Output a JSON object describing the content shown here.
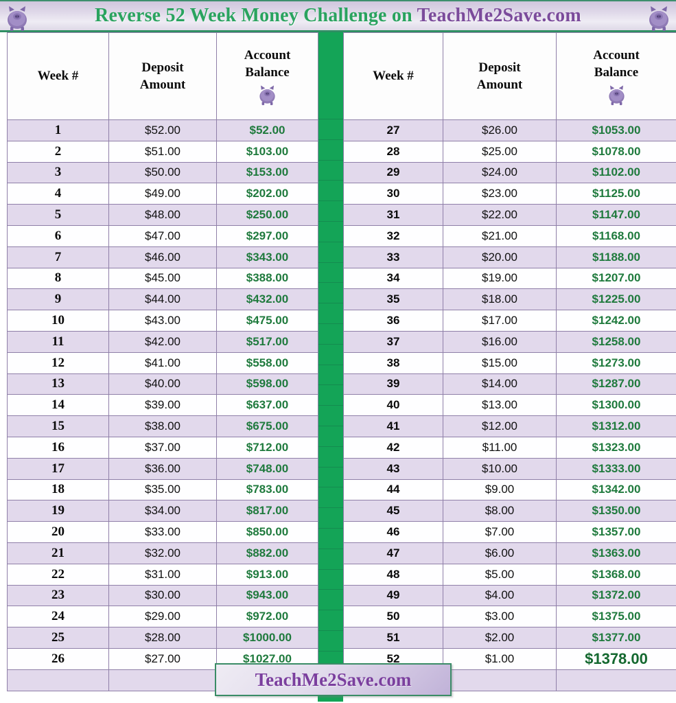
{
  "banner": {
    "title_green": "Reverse 52 Week Money Challenge on ",
    "title_purple": "TeachMe2Save.com",
    "pig_left": "piggy-bank-icon",
    "pig_right": "piggy-bank-icon"
  },
  "columns": {
    "week": "Week #",
    "deposit_line1": "Deposit",
    "deposit_line2": "Amount",
    "balance_line1": "Account",
    "balance_line2": "Balance"
  },
  "colors": {
    "accent_green": "#14a457",
    "band_purple": "#e2d9ec",
    "band_white": "#fefeff",
    "balance_text": "#1f7a3d",
    "brand_purple": "#7b3f9e",
    "grid_line": "#8f7fa8"
  },
  "footer": {
    "badge_label": "TeachMe2Save.com"
  },
  "chart_data": {
    "type": "table",
    "title": "Reverse 52 Week Money Challenge on TeachMe2Save.com",
    "columns": [
      "Week #",
      "Deposit Amount",
      "Account Balance"
    ],
    "grand_total": "$1378.00"
  },
  "left_rows": [
    {
      "week": "1",
      "deposit": "$52.00",
      "balance": "$52.00"
    },
    {
      "week": "2",
      "deposit": "$51.00",
      "balance": "$103.00"
    },
    {
      "week": "3",
      "deposit": "$50.00",
      "balance": "$153.00"
    },
    {
      "week": "4",
      "deposit": "$49.00",
      "balance": "$202.00"
    },
    {
      "week": "5",
      "deposit": "$48.00",
      "balance": "$250.00"
    },
    {
      "week": "6",
      "deposit": "$47.00",
      "balance": "$297.00"
    },
    {
      "week": "7",
      "deposit": "$46.00",
      "balance": "$343.00"
    },
    {
      "week": "8",
      "deposit": "$45.00",
      "balance": "$388.00"
    },
    {
      "week": "9",
      "deposit": "$44.00",
      "balance": "$432.00"
    },
    {
      "week": "10",
      "deposit": "$43.00",
      "balance": "$475.00"
    },
    {
      "week": "11",
      "deposit": "$42.00",
      "balance": "$517.00"
    },
    {
      "week": "12",
      "deposit": "$41.00",
      "balance": "$558.00"
    },
    {
      "week": "13",
      "deposit": "$40.00",
      "balance": "$598.00"
    },
    {
      "week": "14",
      "deposit": "$39.00",
      "balance": "$637.00"
    },
    {
      "week": "15",
      "deposit": "$38.00",
      "balance": "$675.00"
    },
    {
      "week": "16",
      "deposit": "$37.00",
      "balance": "$712.00"
    },
    {
      "week": "17",
      "deposit": "$36.00",
      "balance": "$748.00"
    },
    {
      "week": "18",
      "deposit": "$35.00",
      "balance": "$783.00"
    },
    {
      "week": "19",
      "deposit": "$34.00",
      "balance": "$817.00"
    },
    {
      "week": "20",
      "deposit": "$33.00",
      "balance": "$850.00"
    },
    {
      "week": "21",
      "deposit": "$32.00",
      "balance": "$882.00"
    },
    {
      "week": "22",
      "deposit": "$31.00",
      "balance": "$913.00"
    },
    {
      "week": "23",
      "deposit": "$30.00",
      "balance": "$943.00"
    },
    {
      "week": "24",
      "deposit": "$29.00",
      "balance": "$972.00"
    },
    {
      "week": "25",
      "deposit": "$28.00",
      "balance": "$1000.00"
    },
    {
      "week": "26",
      "deposit": "$27.00",
      "balance": "$1027.00"
    }
  ],
  "right_rows": [
    {
      "week": "27",
      "deposit": "$26.00",
      "balance": "$1053.00"
    },
    {
      "week": "28",
      "deposit": "$25.00",
      "balance": "$1078.00"
    },
    {
      "week": "29",
      "deposit": "$24.00",
      "balance": "$1102.00"
    },
    {
      "week": "30",
      "deposit": "$23.00",
      "balance": "$1125.00"
    },
    {
      "week": "31",
      "deposit": "$22.00",
      "balance": "$1147.00"
    },
    {
      "week": "32",
      "deposit": "$21.00",
      "balance": "$1168.00"
    },
    {
      "week": "33",
      "deposit": "$20.00",
      "balance": "$1188.00"
    },
    {
      "week": "34",
      "deposit": "$19.00",
      "balance": "$1207.00"
    },
    {
      "week": "35",
      "deposit": "$18.00",
      "balance": "$1225.00"
    },
    {
      "week": "36",
      "deposit": "$17.00",
      "balance": "$1242.00"
    },
    {
      "week": "37",
      "deposit": "$16.00",
      "balance": "$1258.00"
    },
    {
      "week": "38",
      "deposit": "$15.00",
      "balance": "$1273.00"
    },
    {
      "week": "39",
      "deposit": "$14.00",
      "balance": "$1287.00"
    },
    {
      "week": "40",
      "deposit": "$13.00",
      "balance": "$1300.00"
    },
    {
      "week": "41",
      "deposit": "$12.00",
      "balance": "$1312.00"
    },
    {
      "week": "42",
      "deposit": "$11.00",
      "balance": "$1323.00"
    },
    {
      "week": "43",
      "deposit": "$10.00",
      "balance": "$1333.00"
    },
    {
      "week": "44",
      "deposit": "$9.00",
      "balance": "$1342.00"
    },
    {
      "week": "45",
      "deposit": "$8.00",
      "balance": "$1350.00"
    },
    {
      "week": "46",
      "deposit": "$7.00",
      "balance": "$1357.00"
    },
    {
      "week": "47",
      "deposit": "$6.00",
      "balance": "$1363.00"
    },
    {
      "week": "48",
      "deposit": "$5.00",
      "balance": "$1368.00"
    },
    {
      "week": "49",
      "deposit": "$4.00",
      "balance": "$1372.00"
    },
    {
      "week": "50",
      "deposit": "$3.00",
      "balance": "$1375.00"
    },
    {
      "week": "51",
      "deposit": "$2.00",
      "balance": "$1377.00"
    },
    {
      "week": "52",
      "deposit": "$1.00",
      "balance": "$1378.00"
    }
  ]
}
